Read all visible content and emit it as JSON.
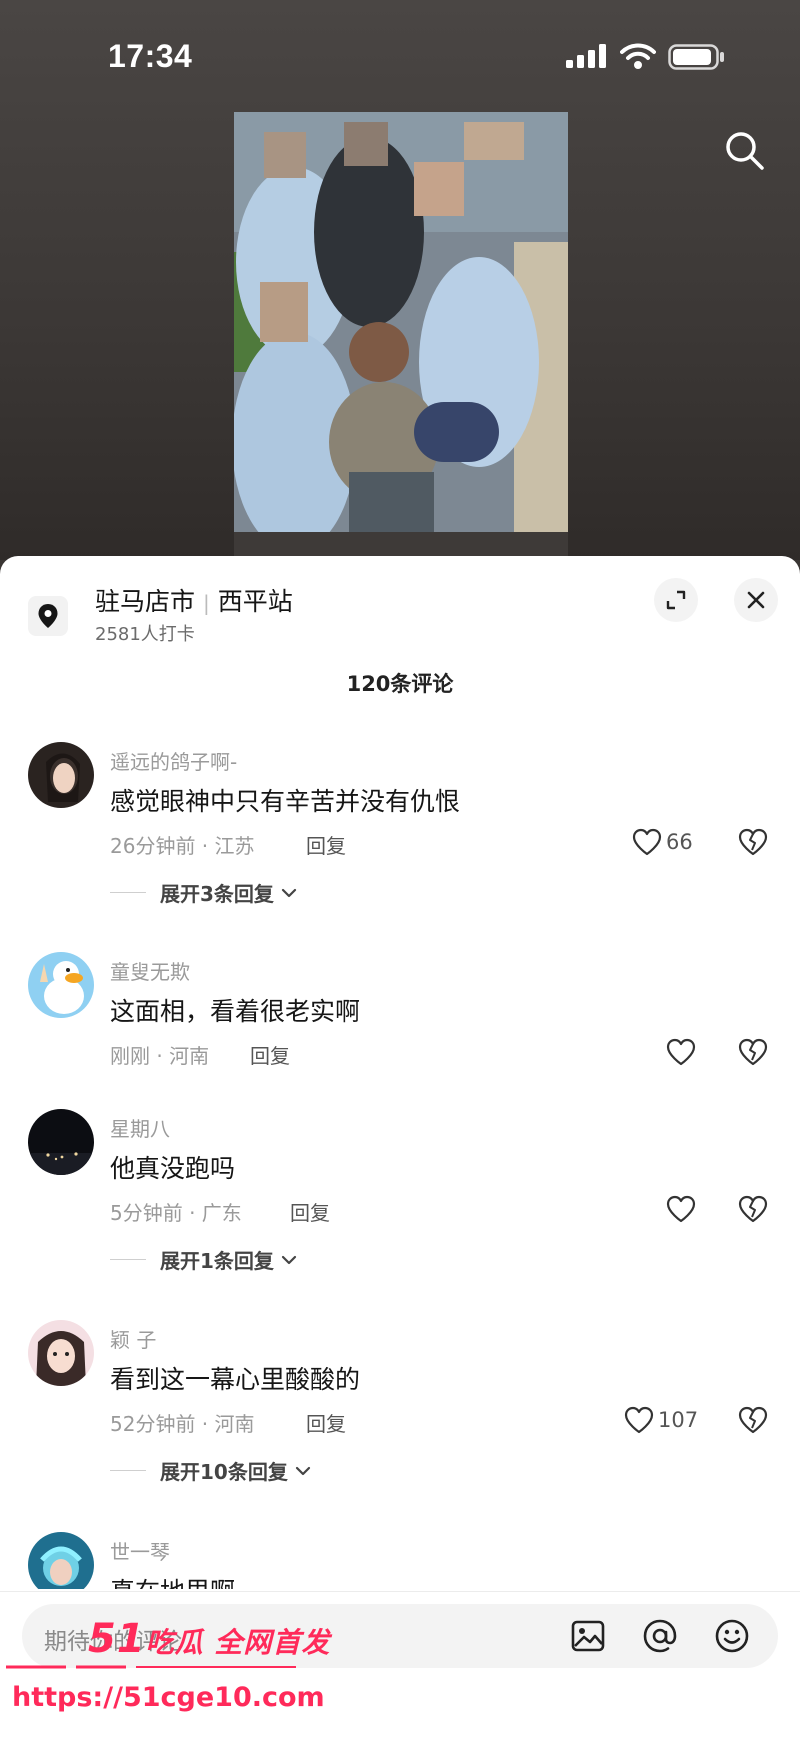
{
  "status_bar": {
    "time": "17:34"
  },
  "location": {
    "city": "驻马店市",
    "place": "西平站",
    "checkins": "2581人打卡"
  },
  "comments_header": {
    "count_label": "120条评论"
  },
  "comments": [
    {
      "user": "遥远的鸽子啊-",
      "text": "感觉眼神中只有辛苦并没有仇恨",
      "meta": "26分钟前 · 江苏",
      "reply": "回复",
      "likes": "66",
      "expand": "展开3条回复"
    },
    {
      "user": "童叟无欺",
      "text": "这面相，看着很老实啊",
      "meta": "刚刚 · 河南",
      "reply": "回复",
      "likes": "",
      "expand": ""
    },
    {
      "user": "星期八",
      "text": "他真没跑吗",
      "meta": "5分钟前 · 广东",
      "reply": "回复",
      "likes": "",
      "expand": "展开1条回复"
    },
    {
      "user": "颖 子",
      "text": "看到这一幕心里酸酸的",
      "meta": "52分钟前 · 河南",
      "reply": "回复",
      "likes": "107",
      "expand": "展开10条回复"
    },
    {
      "user": "世一琴",
      "text": "真在地里啊",
      "meta": "",
      "reply": "",
      "likes": "",
      "expand": ""
    }
  ],
  "input": {
    "placeholder": "期待你的评论"
  },
  "watermark": {
    "brand_num": "51",
    "brand_text": "吃瓜 全网首发",
    "url": "https://51cge10.com"
  },
  "icons": {
    "search": "search-icon",
    "expand": "expand-icon",
    "close": "close-icon",
    "pin": "location-pin-icon",
    "like": "heart-icon",
    "dislike": "broken-heart-icon",
    "image": "image-icon",
    "at": "at-icon",
    "emoji": "emoji-icon"
  },
  "colors": {
    "accent_watermark": "#ff2a5a",
    "sheet_bg": "#ffffff",
    "video_bg": "#3a3634"
  }
}
